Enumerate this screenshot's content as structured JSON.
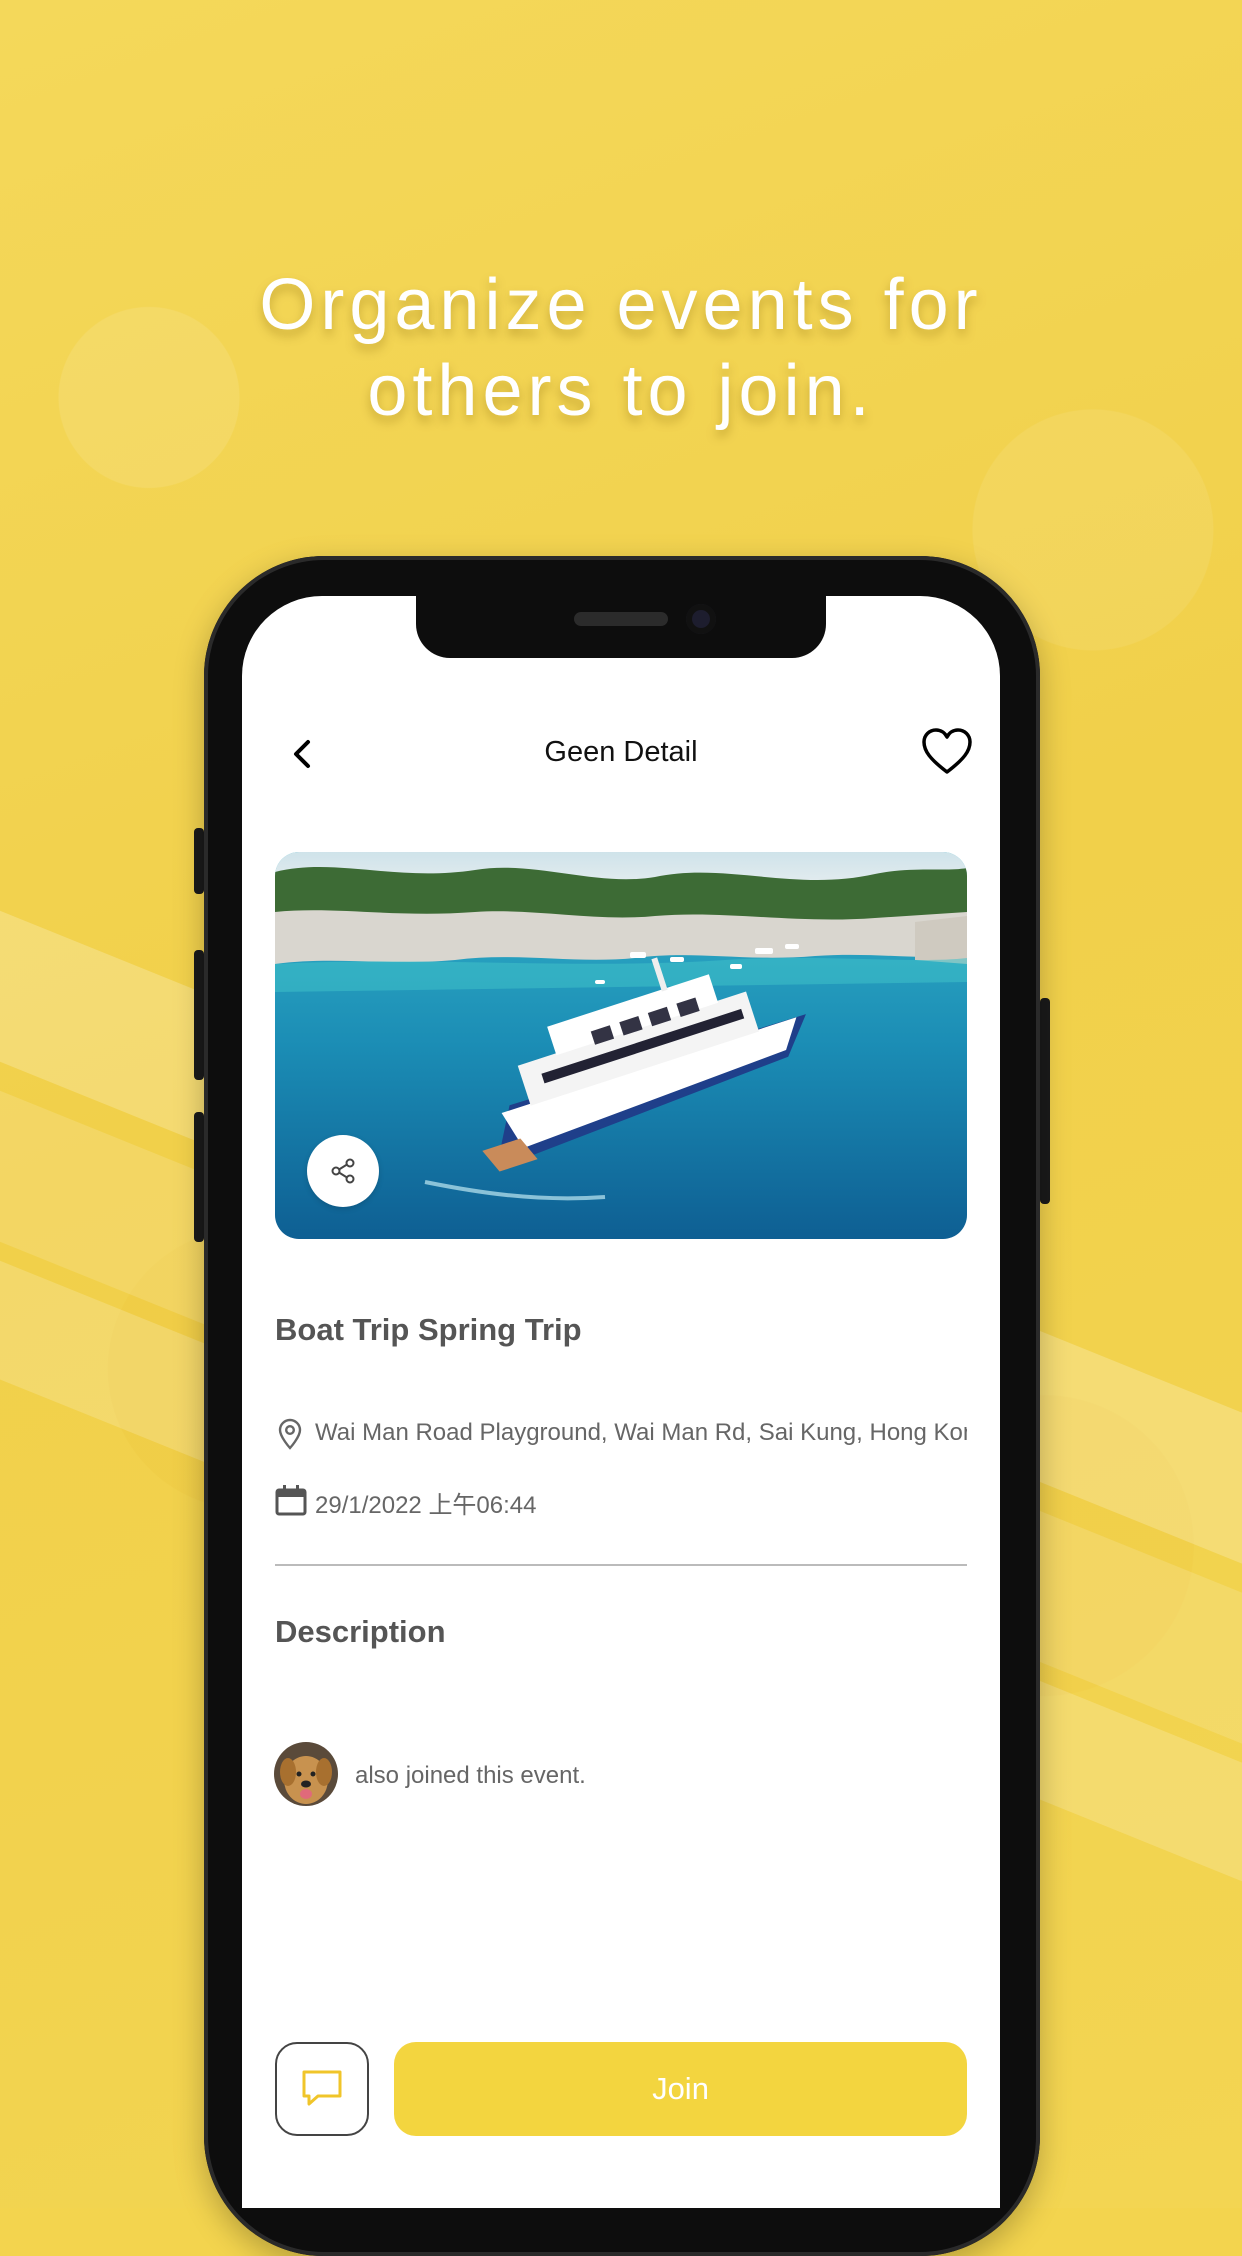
{
  "headline": {
    "line1": "Organize events for",
    "line2": "others to join."
  },
  "screen": {
    "header": {
      "title": "Geen Detail",
      "back_icon": "chevron-left-icon",
      "favorite_icon": "heart-outline-icon"
    },
    "event": {
      "title": "Boat Trip Spring Trip",
      "location": "Wai Man Road Playground, Wai Man Rd, Sai Kung, Hong Kong",
      "date": "29/1/2022 上午06:44",
      "description_heading": "Description",
      "joined_text": "also joined this event."
    },
    "actions": {
      "join_label": "Join",
      "chat_icon": "chat-bubble-icon",
      "share_icon": "share-icon"
    }
  },
  "colors": {
    "background": "#f3d44e",
    "join_button": "#f3d53f",
    "text_primary": "#555555"
  }
}
